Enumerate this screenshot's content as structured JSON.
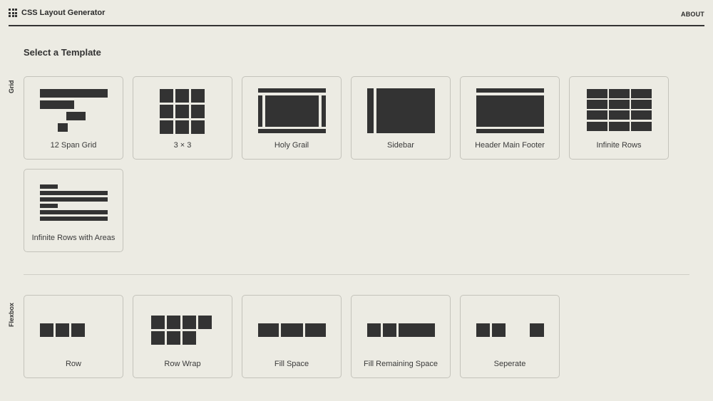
{
  "header": {
    "app_title": "CSS Layout Generator",
    "logo_icon": "grid-icon",
    "about_label": "ABOUT"
  },
  "main": {
    "heading": "Select a Template",
    "grid_section": {
      "label": "Grid",
      "templates": [
        {
          "label": "12 Span Grid",
          "icon": "twelve-span-grid-icon"
        },
        {
          "label": "3 × 3",
          "icon": "three-by-three-icon"
        },
        {
          "label": "Holy Grail",
          "icon": "holy-grail-icon"
        },
        {
          "label": "Sidebar",
          "icon": "sidebar-layout-icon"
        },
        {
          "label": "Header Main Footer",
          "icon": "header-main-footer-icon"
        },
        {
          "label": "Infinite Rows",
          "icon": "infinite-rows-icon"
        },
        {
          "label": "Infinite Rows with Areas",
          "icon": "infinite-rows-areas-icon"
        }
      ]
    },
    "flexbox_section": {
      "label": "Flexbox",
      "templates": [
        {
          "label": "Row",
          "icon": "row-icon"
        },
        {
          "label": "Row Wrap",
          "icon": "row-wrap-icon"
        },
        {
          "label": "Fill Space",
          "icon": "fill-space-icon"
        },
        {
          "label": "Fill Remaining Space",
          "icon": "fill-remaining-space-icon"
        },
        {
          "label": "Seperate",
          "icon": "seperate-icon"
        }
      ]
    }
  },
  "colors": {
    "background": "#ecebe3",
    "ink": "#333333",
    "card_border": "#c4c3bb"
  }
}
